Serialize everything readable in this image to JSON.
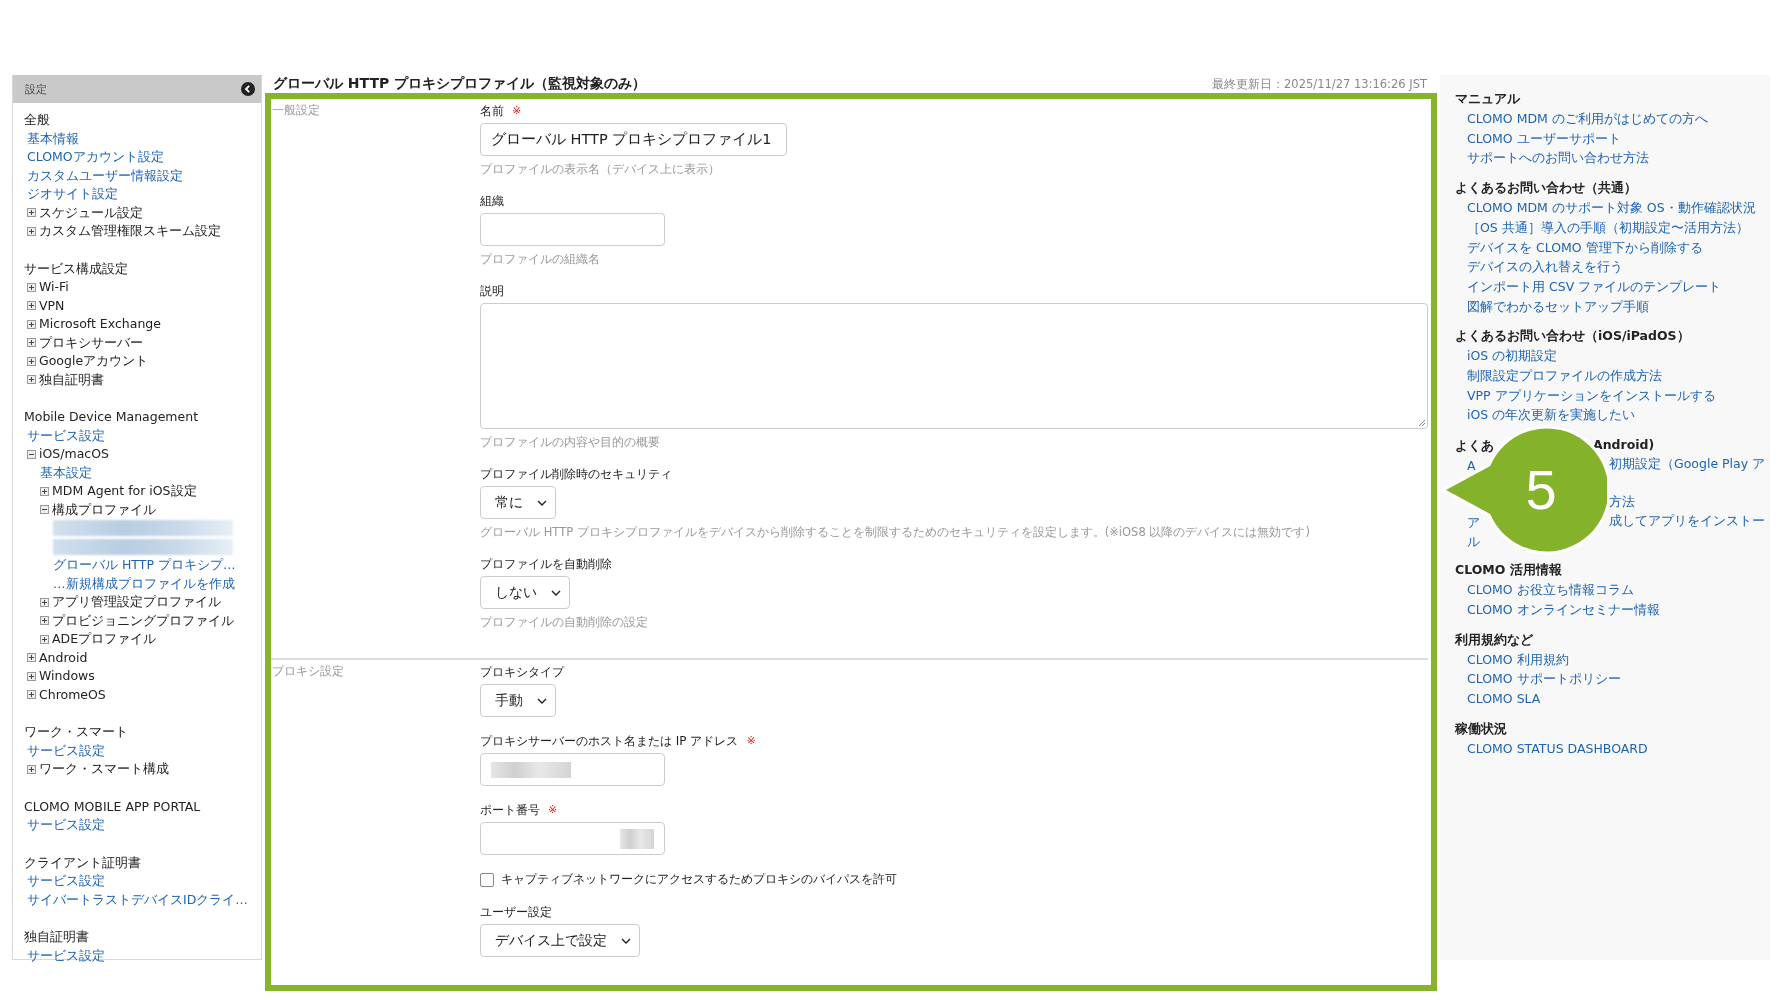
{
  "sidebar": {
    "title": "設定",
    "sections": [
      {
        "title": "全般",
        "items": [
          {
            "kind": "link",
            "label": "基本情報"
          },
          {
            "kind": "link",
            "label": "CLOMOアカウント設定"
          },
          {
            "kind": "link",
            "label": "カスタムユーザー情報設定"
          },
          {
            "kind": "link",
            "label": "ジオサイト設定"
          },
          {
            "kind": "node",
            "label": "スケジュール設定",
            "expanded": false
          },
          {
            "kind": "node",
            "label": "カスタム管理権限スキーム設定",
            "expanded": false
          }
        ]
      },
      {
        "title": "サービス構成設定",
        "items": [
          {
            "kind": "node",
            "label": "Wi-Fi",
            "expanded": false
          },
          {
            "kind": "node",
            "label": "VPN",
            "expanded": false
          },
          {
            "kind": "node",
            "label": "Microsoft Exchange",
            "expanded": false
          },
          {
            "kind": "node",
            "label": "プロキシサーバー",
            "expanded": false
          },
          {
            "kind": "node",
            "label": "Googleアカウント",
            "expanded": false
          },
          {
            "kind": "node",
            "label": "独自証明書",
            "expanded": false
          }
        ]
      },
      {
        "title": "Mobile Device Management",
        "items": [
          {
            "kind": "link",
            "label": "サービス設定"
          },
          {
            "kind": "node",
            "label": "iOS/macOS",
            "expanded": true,
            "children": [
              {
                "kind": "link",
                "label": "基本設定"
              },
              {
                "kind": "node",
                "label": "MDM Agent for iOS設定",
                "expanded": false
              },
              {
                "kind": "node",
                "label": "構成プロファイル",
                "expanded": true,
                "children": [
                  {
                    "kind": "redacted"
                  },
                  {
                    "kind": "redacted"
                  },
                  {
                    "kind": "link",
                    "label": "グローバル HTTP プロキシプ…"
                  },
                  {
                    "kind": "link",
                    "label": "…新規構成プロファイルを作成"
                  }
                ]
              },
              {
                "kind": "node",
                "label": "アプリ管理設定プロファイル",
                "expanded": false
              },
              {
                "kind": "node",
                "label": "プロビジョニングプロファイル",
                "expanded": false
              },
              {
                "kind": "node",
                "label": "ADEプロファイル",
                "expanded": false
              }
            ]
          },
          {
            "kind": "node",
            "label": "Android",
            "expanded": false
          },
          {
            "kind": "node",
            "label": "Windows",
            "expanded": false
          },
          {
            "kind": "node",
            "label": "ChromeOS",
            "expanded": false
          }
        ]
      },
      {
        "title": "ワーク・スマート",
        "items": [
          {
            "kind": "link",
            "label": "サービス設定"
          },
          {
            "kind": "node",
            "label": "ワーク・スマート構成",
            "expanded": false
          }
        ]
      },
      {
        "title": "CLOMO MOBILE APP PORTAL",
        "items": [
          {
            "kind": "link",
            "label": "サービス設定"
          }
        ]
      },
      {
        "title": "クライアント証明書",
        "items": [
          {
            "kind": "link",
            "label": "サービス設定"
          },
          {
            "kind": "link",
            "label": "サイバートラストデバイスIDクライ…"
          }
        ]
      },
      {
        "title": "独自証明書",
        "items": [
          {
            "kind": "link",
            "label": "サービス設定"
          }
        ]
      }
    ]
  },
  "page": {
    "title": "グローバル HTTP プロキシプロファイル（監視対象のみ）",
    "updated": "最終更新日：2025/11/27 13:16:26 JST"
  },
  "form": {
    "sections": [
      {
        "title": "一般設定",
        "fields": [
          {
            "kind": "text",
            "label": "名前",
            "required_mark": "※",
            "value": "グローバル HTTP プロキシプロファイル1",
            "help": "プロファイルの表示名（デバイス上に表示）"
          },
          {
            "kind": "text",
            "label": "組織",
            "help": "プロファイルの組織名"
          },
          {
            "kind": "textarea",
            "label": "説明",
            "help": "プロファイルの内容や目的の概要"
          },
          {
            "kind": "select",
            "label": "プロファイル削除時のセキュリティ",
            "value": "常に",
            "help": "グローバル HTTP プロキシプロファイルをデバイスから削除することを制限するためのセキュリティを設定します。(※iOS8 以降のデバイスには無効です)"
          },
          {
            "kind": "select",
            "label": "プロファイルを自動削除",
            "value": "しない",
            "help": "プロファイルの自動削除の設定"
          }
        ]
      },
      {
        "title": "プロキシ設定",
        "fields": [
          {
            "kind": "select",
            "label": "プロキシタイプ",
            "value": "手動"
          },
          {
            "kind": "text",
            "label": "プロキシサーバーのホスト名または IP アドレス",
            "required_mark": "※",
            "masked": true
          },
          {
            "kind": "text",
            "label": "ポート番号",
            "required_mark": "※",
            "masked": true,
            "numeric": true
          },
          {
            "kind": "checkbox",
            "label": "キャプティブネットワークにアクセスするためプロキシのバイパスを許可",
            "checked": false
          },
          {
            "kind": "select",
            "label": "ユーザー設定",
            "value": "デバイス上で設定"
          }
        ]
      }
    ]
  },
  "help_panel": {
    "groups": [
      {
        "kind": "plain",
        "title": "マニュアル",
        "links": [
          "CLOMO MDM のご利用がはじめての方へ",
          "CLOMO ユーザーサポート",
          "サポートへのお問い合わせ方法"
        ]
      },
      {
        "kind": "plain",
        "title": "よくあるお問い合わせ（共通）",
        "links": [
          "CLOMO MDM のサポート対象 OS・動作確認状況",
          "［OS 共通］導入の手順（初期設定〜活用方法）",
          "デバイスを CLOMO 管理下から削除する",
          "デバイスの入れ替えを行う",
          "インポート用 CSV ファイルのテンプレート",
          "図解でわかるセットアップ手順"
        ]
      },
      {
        "kind": "plain",
        "title": "よくあるお問い合わせ（iOS/iPadOS）",
        "links": [
          "iOS の初期設定",
          "制限設定プロファイルの作成方法",
          "VPP アプリケーションをインストールする",
          "iOS の年次更新を実施したい"
        ]
      },
      {
        "kind": "covered",
        "title_left": "よくあ",
        "title_right": "Android)",
        "rows": [
          {
            "left": "A",
            "right": "初期設定（Google Play ア"
          },
          {
            "right": "方法"
          },
          {
            "left": "ア",
            "right": "成してアプリをインストー"
          },
          {
            "left": "ル"
          }
        ],
        "callout": "5"
      },
      {
        "kind": "plain",
        "title": "CLOMO 活用情報",
        "links": [
          "CLOMO お役立ち情報コラム",
          "CLOMO オンラインセミナー情報"
        ]
      },
      {
        "kind": "plain",
        "title": "利用規約など",
        "links": [
          "CLOMO 利用規約",
          "CLOMO サポートポリシー",
          "CLOMO SLA"
        ]
      },
      {
        "kind": "plain",
        "title": "稼働状況",
        "links": [
          "CLOMO STATUS DASHBOARD"
        ]
      }
    ]
  }
}
